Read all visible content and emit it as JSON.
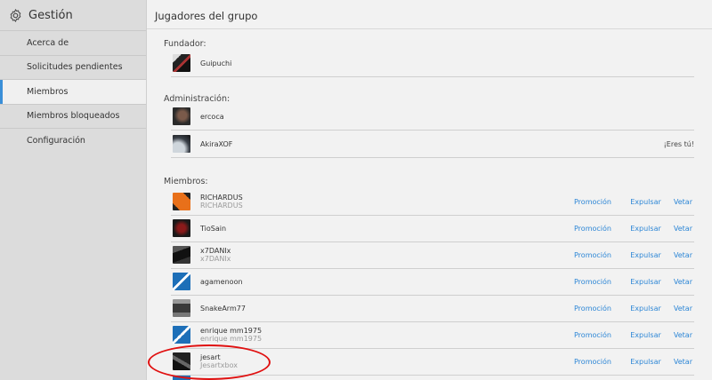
{
  "sidebar": {
    "title": "Gestión",
    "items": [
      {
        "label": "Acerca de"
      },
      {
        "label": "Solicitudes pendientes"
      },
      {
        "label": "Miembros"
      },
      {
        "label": "Miembros bloqueados"
      },
      {
        "label": "Configuración"
      }
    ]
  },
  "main": {
    "title": "Jugadores del grupo",
    "founder": {
      "label": "Fundador:",
      "players": [
        {
          "name": "Guipuchi",
          "icon": "avatar-knight"
        }
      ]
    },
    "admins": {
      "label": "Administración:",
      "players": [
        {
          "name": "ercoca",
          "icon": "avatar-soldier"
        },
        {
          "name": "AkiraXOF",
          "icon": "avatar-planet",
          "note": "¡Eres tú!"
        }
      ]
    },
    "members": {
      "label": "Miembros:",
      "players": [
        {
          "name": "RICHARDUS",
          "gamertag": "RICHARDUS",
          "icon": "avatar-orange-diamond"
        },
        {
          "name": "TioSain",
          "icon": "avatar-dark-red"
        },
        {
          "name": "x7DANIx",
          "gamertag": "x7DANIx",
          "icon": "avatar-dark"
        },
        {
          "name": "agamenoon",
          "icon": "avatar-blue-logo"
        },
        {
          "name": "SnakeArm77",
          "icon": "avatar-grey-soldier"
        },
        {
          "name": "enrique mm1975",
          "gamertag": "enrique mm1975",
          "icon": "avatar-blue-logo"
        },
        {
          "name": "jesart",
          "gamertag": "Jesartxbox",
          "icon": "avatar-dark-car"
        }
      ]
    },
    "actions": {
      "promote": "Promoción",
      "expel": "Expulsar",
      "ban": "Vetar"
    }
  },
  "colors": {
    "link": "#2c86d6",
    "active_marker": "#3a8fd8",
    "annotation": "#e01010"
  }
}
